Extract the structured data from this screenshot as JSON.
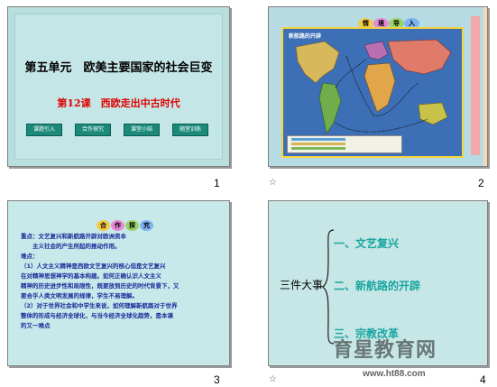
{
  "slides": [
    {
      "number": "1",
      "title": "第五单元　欧美主要国家的社会巨变",
      "subtitle": "第12课　西欧走出中古时代",
      "buttons": [
        "课题引入",
        "合作探究",
        "课堂小结",
        "随堂训练"
      ]
    },
    {
      "number": "2",
      "tabs": [
        "情",
        "境",
        "导",
        "入"
      ],
      "map_title": "新航路的开辟",
      "footer_mark": "☆"
    },
    {
      "number": "3",
      "tabs": [
        "合",
        "作",
        "探",
        "究"
      ],
      "lines": [
        "重点：文艺复兴和新航路开辟对欧洲资本",
        "　　主义社会的产生所起的推动作用。",
        "难点：",
        "（1）人文主义精神是西欧文艺复兴的核心但是文艺复兴",
        "在对精神思想神学的基本构建。如何正确认识人文主义",
        "精神的历史进步性和局限性，既要放到历史的时代背景下，又",
        "要合乎人类文明发展的规律，学生不易理解。",
        "（2）对于世界社会和中学生来说，如何理解新航路对于世界",
        "整体的形成与经济全球化，与当今经济全球化趋势，是本课",
        "的又一难点"
      ]
    },
    {
      "number": "4",
      "heading": "三件大事",
      "items": [
        "一、文艺复兴",
        "二、新航路的开辟",
        "三、宗教改革"
      ],
      "footer_mark": "☆"
    }
  ],
  "watermark": {
    "text": "育星教育网",
    "url": "www.ht88.com"
  },
  "colors": {
    "button": "#1c8a7a",
    "subtitle_red": "#e00000",
    "teal_text": "#17a6a0",
    "blue_text": "#1a2a9a"
  }
}
